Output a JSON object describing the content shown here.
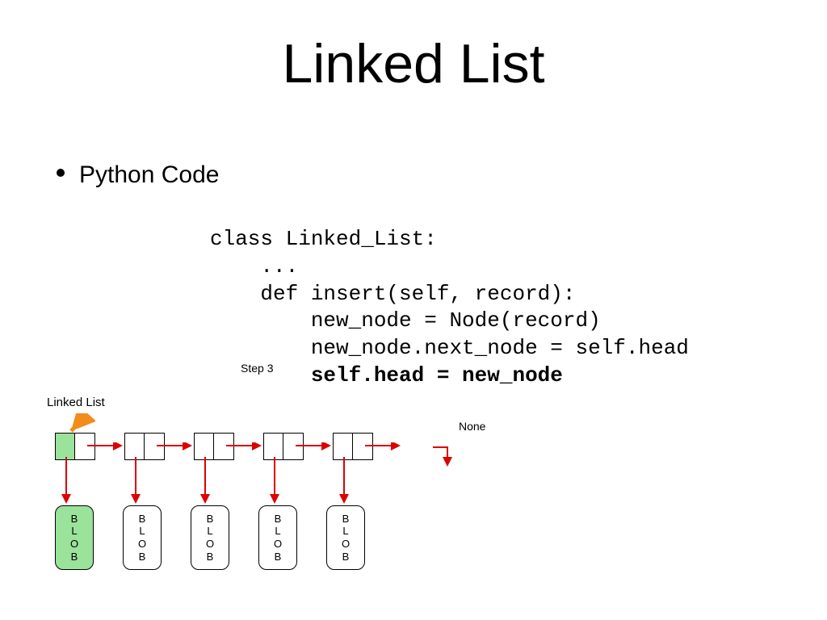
{
  "title": "Linked List",
  "bullet": "Python Code",
  "code": {
    "l1": "class Linked_List:",
    "l2": "    ...",
    "l3": "    def insert(self, record):",
    "l4": "        new_node = Node(record)",
    "l5": "        new_node.next_node = self.head",
    "l6": "        self.head = new_node"
  },
  "diagram": {
    "step": "Step 3",
    "label": "Linked List",
    "none": "None",
    "blob": {
      "l1": "B",
      "l2": "L",
      "l3": "O",
      "l4": "B"
    }
  }
}
